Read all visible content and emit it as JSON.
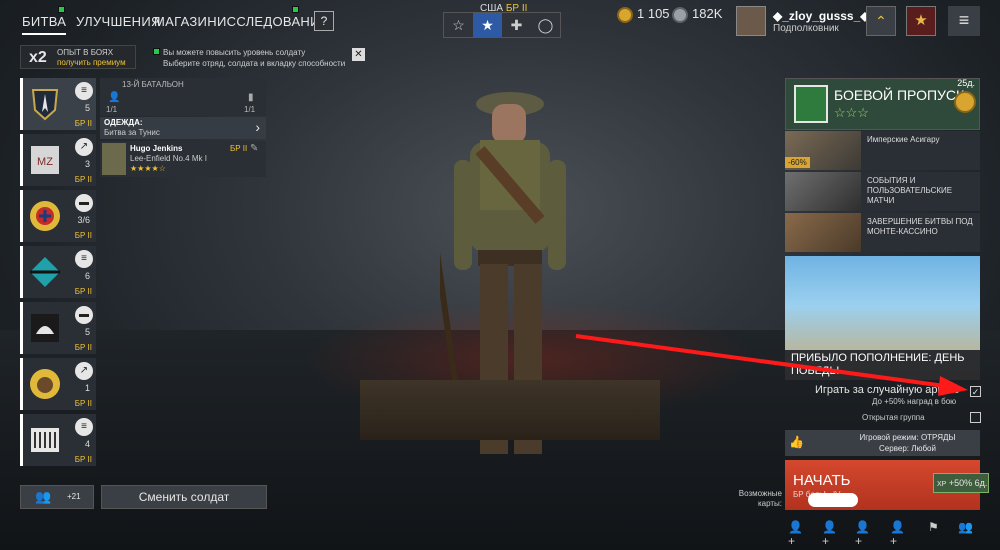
{
  "topnav": {
    "battle": "БИТВА",
    "upgrades": "УЛУЧШЕНИЯ",
    "shop": "МАГАЗИН",
    "research": "ИССЛЕДОВАНИЯ",
    "help": "?"
  },
  "army": {
    "nation": "США",
    "br": "БР II",
    "tabs": [
      "☆",
      "★",
      "✚",
      "◯"
    ]
  },
  "currency": {
    "gold": "1 105",
    "silver": "182K"
  },
  "user": {
    "name": "◆_zloy_gusss_◆",
    "rank": "Подполковник",
    "menu": "≡"
  },
  "premium": {
    "mult": "x2",
    "line1": "ОПЫТ В БОЯХ",
    "line2": "получить премиум"
  },
  "notice": {
    "line1": "Вы можете повысить уровень солдату",
    "line2": "Выберите отряд, солдата и вкладку способности",
    "close": "✕"
  },
  "squads": [
    {
      "count": "5",
      "br": "БР II"
    },
    {
      "count": "3",
      "br": "БР II"
    },
    {
      "count": "3/6",
      "br": "БР II"
    },
    {
      "count": "6",
      "br": "БР II"
    },
    {
      "count": "5",
      "br": "БР II"
    },
    {
      "count": "1",
      "br": "БР II"
    },
    {
      "count": "4",
      "br": "БР II"
    }
  ],
  "detail": {
    "battalion": "13-Й БАТАЛЬОН",
    "a": "1/1",
    "b": "1/1",
    "outfit": "ОДЕЖДА:",
    "outfit_sub": "Битва за Тунис",
    "soldier_name": "Hugo Jenkins",
    "weapon": "Lee-Enfield No.4 Mk I",
    "soldier_br": "БР II",
    "stars": "★★★★☆"
  },
  "bottom_left": {
    "squad_count": "+21",
    "change": "Сменить солдат"
  },
  "battlepass": {
    "title": "БОЕВОЙ ПРОПУСК",
    "stars": "☆☆☆",
    "days": "25д."
  },
  "cards": [
    {
      "text": "Имперские Асигару",
      "badge": "-60%"
    },
    {
      "text": "СОБЫТИЯ И ПОЛЬЗОВАТЕЛЬСКИЕ МАТЧИ"
    },
    {
      "text": "ЗАВЕРШЕНИЕ БИТВЫ ПОД МОНТЕ-КАССИНО"
    }
  ],
  "banner": "ПРИБЫЛО ПОПОЛНЕНИЕ: ДЕНЬ ПОБЕДЫ",
  "random_army": {
    "label": "Играть за случайную армию",
    "bonus": "До +50% наград в бою"
  },
  "open_group": "Открытая группа",
  "mode": {
    "line1": "Игровой режим: ОТРЯДЫ",
    "line2": "Сервер: Любой"
  },
  "start": {
    "label": "НАЧАТЬ",
    "sub": "БР боя: I - IV",
    "xp": "+50% 6д."
  },
  "maps_label": "Возможные карты:",
  "colors": {
    "accent": "#f1c232",
    "start": "#c63c26",
    "arrow": "#ff1a1a"
  }
}
